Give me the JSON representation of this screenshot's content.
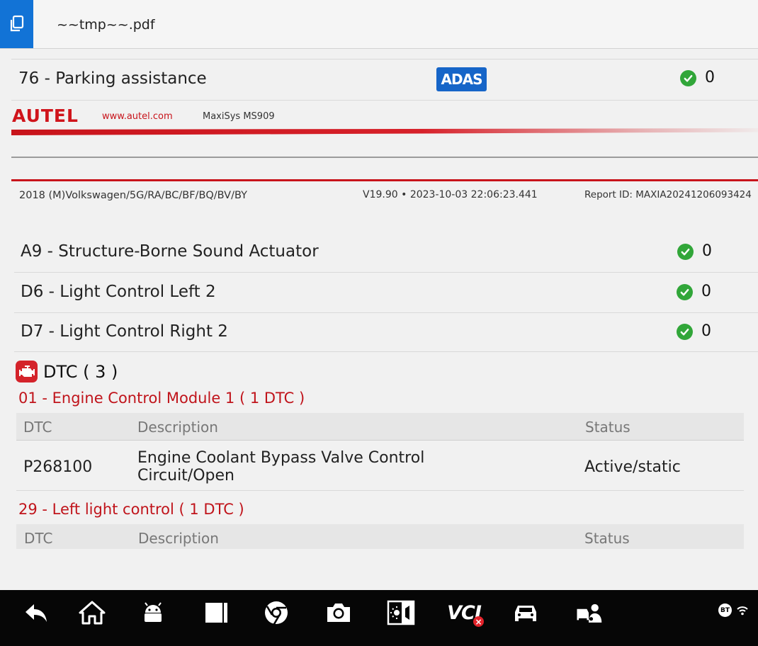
{
  "header": {
    "file_name": "~~tmp~~.pdf",
    "icon": "document-copy-icon"
  },
  "parking": {
    "name": "76 - Parking assistance",
    "badge": "ADAS",
    "count": "0"
  },
  "brand": {
    "logo": "AUTEL",
    "url": "www.autel.com",
    "model": "MaxiSys MS909"
  },
  "report_info": {
    "vehicle": "2018 (M)Volkswagen/5G/RA/BC/BF/BQ/BV/BY",
    "version": "V19.90 • 2023-10-03 22:06:23.441",
    "report_id": "Report ID:  MAXIA20241206093424"
  },
  "modules": [
    {
      "name": "A9 - Structure-Borne Sound Actuator",
      "count": "0"
    },
    {
      "name": "D6 - Light Control Left 2",
      "count": "0"
    },
    {
      "name": "D7 - Light Control Right 2",
      "count": "0"
    }
  ],
  "dtc": {
    "title": "DTC ( 3 )",
    "groups": [
      {
        "title": "01 - Engine Control Module 1 ( 1 DTC )",
        "headers": {
          "dtc": "DTC",
          "description": "Description",
          "status": "Status"
        },
        "rows": [
          {
            "code": "P268100",
            "description_line1": "Engine Coolant Bypass Valve Control",
            "description_line2": "Circuit/Open",
            "status": "Active/static"
          }
        ]
      },
      {
        "title": "29 - Left light control ( 1 DTC )",
        "headers": {
          "dtc": "DTC",
          "description": "Description",
          "status": "Status"
        },
        "rows": []
      }
    ]
  },
  "taskbar": {
    "icons": [
      "back-icon",
      "home-icon",
      "android-icon",
      "multitask-icon",
      "browser-icon",
      "camera-icon",
      "brightness-icon",
      "vci-icon",
      "vehicle-icon",
      "remote-expert-icon"
    ],
    "vci_label": "VCI",
    "bt_label": "BT"
  },
  "colors": {
    "accent_blue": "#1273d6",
    "autel_red": "#c8141b",
    "ok_green": "#31a639"
  }
}
